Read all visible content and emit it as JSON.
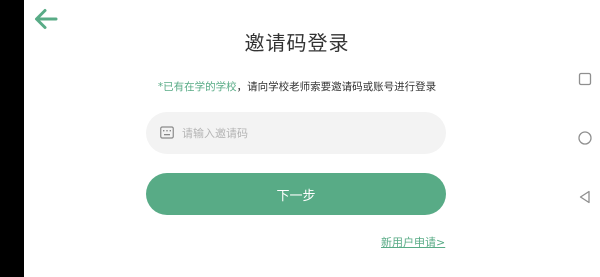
{
  "header": {
    "back_icon": "arrow-left-icon",
    "title": "邀请码登录"
  },
  "hint": {
    "highlight": "*已有在学的学校",
    "rest": "，请向学校老师索要邀请码或账号进行登录"
  },
  "form": {
    "input_icon": "keyboard-icon",
    "code_value": "",
    "code_placeholder": "请输入邀请码",
    "next_label": "下一步",
    "new_user_link": "新用户申请>"
  },
  "system_nav": {
    "recents_icon": "square-icon",
    "home_icon": "circle-icon",
    "back_icon": "triangle-back-icon"
  },
  "colors": {
    "accent": "#58ab86",
    "input_bg": "#f3f3f3",
    "text": "#333333",
    "placeholder": "#b4b4b4",
    "bezel": "#000000"
  }
}
